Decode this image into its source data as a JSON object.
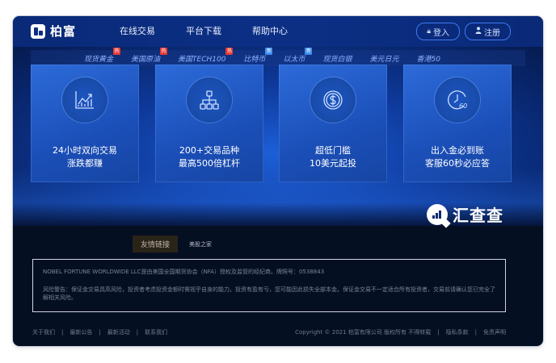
{
  "header": {
    "logo_text": "柏富",
    "nav": [
      "在线交易",
      "平台下载",
      "帮助中心"
    ],
    "login_label": "登入",
    "register_label": "注册"
  },
  "ticker": [
    {
      "label": "现货黄金",
      "badge": "热",
      "badge_type": "hot"
    },
    {
      "label": "美国原油",
      "badge": "热",
      "badge_type": "hot"
    },
    {
      "label": "美国TECH100",
      "badge": "热",
      "badge_type": "hot"
    },
    {
      "label": "比特币",
      "badge": "新",
      "badge_type": "new"
    },
    {
      "label": "以太币",
      "badge": "新",
      "badge_type": "new"
    },
    {
      "label": "现货白银",
      "badge": "",
      "badge_type": ""
    },
    {
      "label": "美元日元",
      "badge": "",
      "badge_type": ""
    },
    {
      "label": "香港50",
      "badge": "",
      "badge_type": ""
    }
  ],
  "cards": [
    {
      "icon": "chart-trend-icon",
      "line1": "24小时双向交易",
      "line2": "涨跌都赚"
    },
    {
      "icon": "hierarchy-icon",
      "line1": "200+交易品种",
      "line2": "最高500倍杠杆"
    },
    {
      "icon": "dollar-coin-icon",
      "line1": "超低门槛",
      "line2": "10美元起投"
    },
    {
      "icon": "clock-60-icon",
      "line1": "出入金必到账",
      "line2": "客服60秒必应答"
    }
  ],
  "card_icon_60_text": "60",
  "watermark": {
    "text": "汇查查"
  },
  "footer": {
    "links_tag": "友情链接",
    "links": [
      "美股之家"
    ],
    "disclaimer_p1": "NOBEL FORTUNE WORLDWIDE LLC是由美国全国期货协会（NFA）授权及监管的经纪商。牌照号：0538843",
    "disclaimer_p2": "风险警告：保证金交易具高风险，投资者考虑投资金额时需视乎自身的能力。投资有盈有亏，您可能因此损失全部本金。保证金交易不一定适合所有投资者，交易前请确认您已完全了解相关风险。",
    "bottom_left": [
      "关于我们",
      "最新公告",
      "最新活动",
      "联系我们"
    ],
    "copyright": "Copyright © 2021 柏富有限公司 版权所有 不得转载",
    "bottom_right": [
      "隐私条款",
      "免责声明"
    ]
  }
}
